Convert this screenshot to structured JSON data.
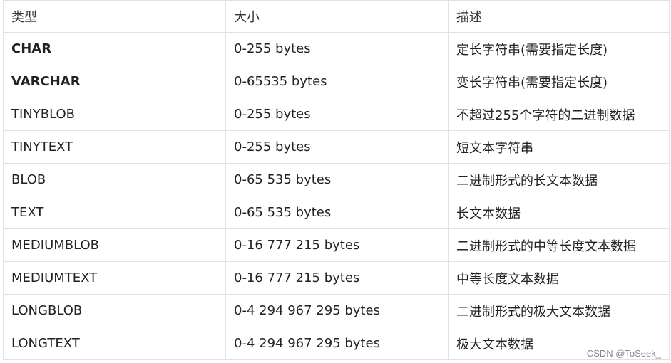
{
  "table": {
    "headers": [
      "类型",
      "大小",
      "描述"
    ],
    "rows": [
      {
        "type": "CHAR",
        "size": "0-255 bytes",
        "desc": "定长字符串(需要指定长度)",
        "bold": true
      },
      {
        "type": "VARCHAR",
        "size": "0-65535 bytes",
        "desc": "变长字符串(需要指定长度)",
        "bold": true
      },
      {
        "type": "TINYBLOB",
        "size": "0-255 bytes",
        "desc": "不超过255个字符的二进制数据",
        "bold": false
      },
      {
        "type": "TINYTEXT",
        "size": "0-255 bytes",
        "desc": "短文本字符串",
        "bold": false
      },
      {
        "type": "BLOB",
        "size": "0-65 535 bytes",
        "desc": "二进制形式的长文本数据",
        "bold": false
      },
      {
        "type": "TEXT",
        "size": "0-65 535 bytes",
        "desc": "长文本数据",
        "bold": false
      },
      {
        "type": "MEDIUMBLOB",
        "size": "0-16 777 215 bytes",
        "desc": "二进制形式的中等长度文本数据",
        "bold": false
      },
      {
        "type": "MEDIUMTEXT",
        "size": "0-16 777 215 bytes",
        "desc": "中等长度文本数据",
        "bold": false
      },
      {
        "type": "LONGBLOB",
        "size": "0-4 294 967 295 bytes",
        "desc": "二进制形式的极大文本数据",
        "bold": false
      },
      {
        "type": "LONGTEXT",
        "size": "0-4 294 967 295 bytes",
        "desc": "极大文本数据",
        "bold": false
      }
    ]
  },
  "watermark": "CSDN @ToSeek_"
}
